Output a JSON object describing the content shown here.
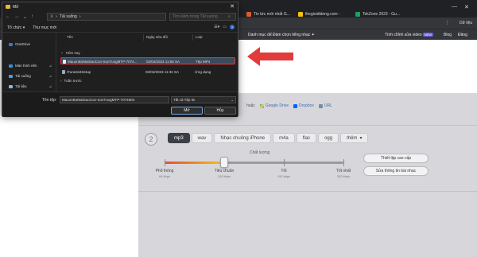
{
  "browser": {
    "tabs": [
      {
        "label": "Tin tức mới nhất G...",
        "color": "#e05a2b"
      },
      {
        "label": "thegioididong.com -",
        "color": "#f4c20d"
      },
      {
        "label": "TekZone 2023 - Gu...",
        "color": "#1aa260"
      }
    ],
    "menu_label": "Dữ liệu",
    "bookmarks": {
      "item1": "Danh mục đế",
      "item2": "Đàm chọn tiếng nhạc ✦",
      "item3": "Tính chỉnh sửa video",
      "item3_badge": "NEW",
      "item4": "Blog",
      "item5": "Đăng"
    }
  },
  "site": {
    "upload_from": "hoặc",
    "upload_sources": [
      "Google Drive",
      "Dropbox",
      "URL"
    ],
    "step_number": "2",
    "formats": [
      {
        "label": "mp3",
        "active": true
      },
      {
        "label": "wav",
        "active": false
      },
      {
        "label": "Nhạc chuông iPhone",
        "active": false
      },
      {
        "label": "m4a",
        "active": false
      },
      {
        "label": "flac",
        "active": false
      },
      {
        "label": "ogg",
        "active": false
      },
      {
        "label": "thêm",
        "active": false,
        "caret": "▾"
      }
    ],
    "quality_label": "Chất lượng",
    "quality_levels": [
      {
        "label": "Phổ thông",
        "sub": "64 kbps"
      },
      {
        "label": "Tiêu chuẩn",
        "sub": "128 kbps"
      },
      {
        "label": "Tốt",
        "sub": "192 kbps"
      },
      {
        "label": "Tốt nhất",
        "sub": "320 kbps"
      }
    ],
    "quality_selected_index": 1,
    "advanced_button": "Thiết lập cao cấp",
    "edit_info_button": "Sửa thông tin bài nhạc"
  },
  "dialog": {
    "title": "Mở",
    "close_glyph": "✕",
    "path": [
      "Tải xuống"
    ],
    "search_placeholder": "Tìm kiếm trong Tải xuống",
    "toolbar": {
      "organize": "Tổ chức ▾",
      "new_folder": "Thư mục mới"
    },
    "sidebar": [
      {
        "label": "OneDrive",
        "color": "#2f7bd6",
        "selected": false
      },
      {
        "label": "Màn hình nền",
        "color": "#3a8ee6",
        "selected": false
      },
      {
        "label": "Tải xuống",
        "color": "#3fa0f0",
        "selected": false
      },
      {
        "label": "Tài liệu",
        "color": "#8fb4e8",
        "selected": false
      }
    ],
    "columns": {
      "name": "Tên",
      "date": "Ngày sửa đổi",
      "type": "Loại"
    },
    "groups": {
      "today": "Hôm nay",
      "last_week": "Tuần trước"
    },
    "files": [
      {
        "name": "MauonBoMatSaoCon-SonTungMTP-7074...",
        "date": "02/04/2023 11:56 SA",
        "type": "Tệp MP4",
        "selected": true
      },
      {
        "name": "iTunes64Setup",
        "date": "02/04/2023 11:33 SA",
        "type": "Ứng dụng",
        "selected": false
      }
    ],
    "filename_label": "Tên tệp:",
    "filename_value": "MauonBoMatSaoCon-SonTungMTP-7074803",
    "filetype_value": "Tất cả Tệp tin",
    "open_button": "Mở",
    "cancel_button": "Hủy"
  },
  "colors": {
    "accent_red": "#e23b3b",
    "slider_gradient_start": "#e74c3c",
    "slider_gradient_end": "#f1c40f"
  }
}
